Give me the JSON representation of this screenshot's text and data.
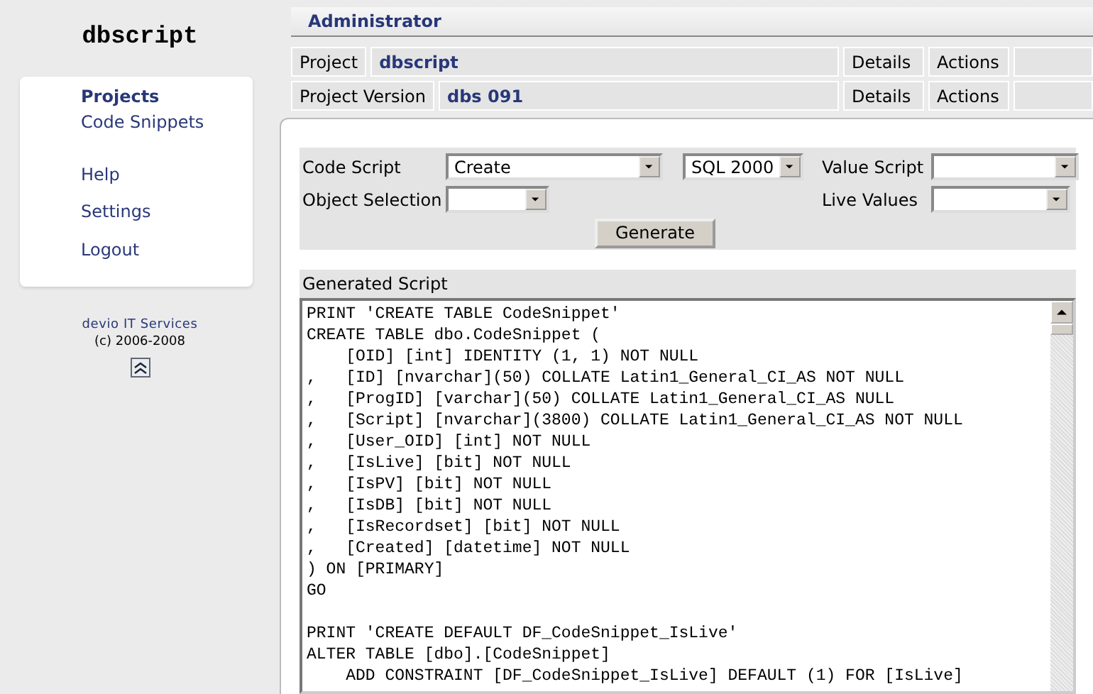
{
  "app_title": "dbscript",
  "sidebar": {
    "main_items": [
      {
        "label": "Projects",
        "selected": true
      },
      {
        "label": "Code Snippets",
        "selected": false
      }
    ],
    "utility_items": [
      {
        "label": "Help",
        "selected": false
      },
      {
        "label": "Settings",
        "selected": false
      },
      {
        "label": "Logout",
        "selected": false
      }
    ],
    "company": "devio IT Services",
    "copyright": "(c) 2006-2008"
  },
  "header": {
    "user": "Administrator"
  },
  "context_rows": [
    {
      "label": "Project",
      "value": "dbscript",
      "links": [
        "Details",
        "Actions"
      ]
    },
    {
      "label": "Project Version",
      "value": "dbs 091",
      "links": [
        "Details",
        "Actions"
      ]
    }
  ],
  "form": {
    "code_script": {
      "label": "Code Script",
      "value": "Create"
    },
    "dialect": {
      "value": "SQL 2000"
    },
    "value_script": {
      "label": "Value Script"
    },
    "object_selection": {
      "label": "Object Selection"
    },
    "live_values": {
      "label": "Live Values"
    },
    "generate_button": "Generate"
  },
  "output": {
    "label": "Generated Script",
    "blocks": [
      [
        "PRINT 'CREATE TABLE CodeSnippet'",
        "CREATE TABLE dbo.CodeSnippet (",
        "    [OID] [int] IDENTITY (1, 1) NOT NULL",
        ",   [ID] [nvarchar](50) COLLATE Latin1_General_CI_AS NOT NULL",
        ",   [ProgID] [varchar](50) COLLATE Latin1_General_CI_AS NULL",
        ",   [Script] [nvarchar](3800) COLLATE Latin1_General_CI_AS NOT NULL",
        ",   [User_OID] [int] NOT NULL",
        ",   [IsLive] [bit] NOT NULL",
        ",   [IsPV] [bit] NOT NULL",
        ",   [IsDB] [bit] NOT NULL",
        ",   [IsRecordset] [bit] NOT NULL",
        ",   [Created] [datetime] NOT NULL",
        ") ON [PRIMARY]",
        "GO"
      ],
      [
        "PRINT 'CREATE DEFAULT DF_CodeSnippet_IsLive'",
        "ALTER TABLE [dbo].[CodeSnippet]",
        "    ADD CONSTRAINT [DF_CodeSnippet_IsLive] DEFAULT (1) FOR [IsLive]"
      ]
    ]
  }
}
